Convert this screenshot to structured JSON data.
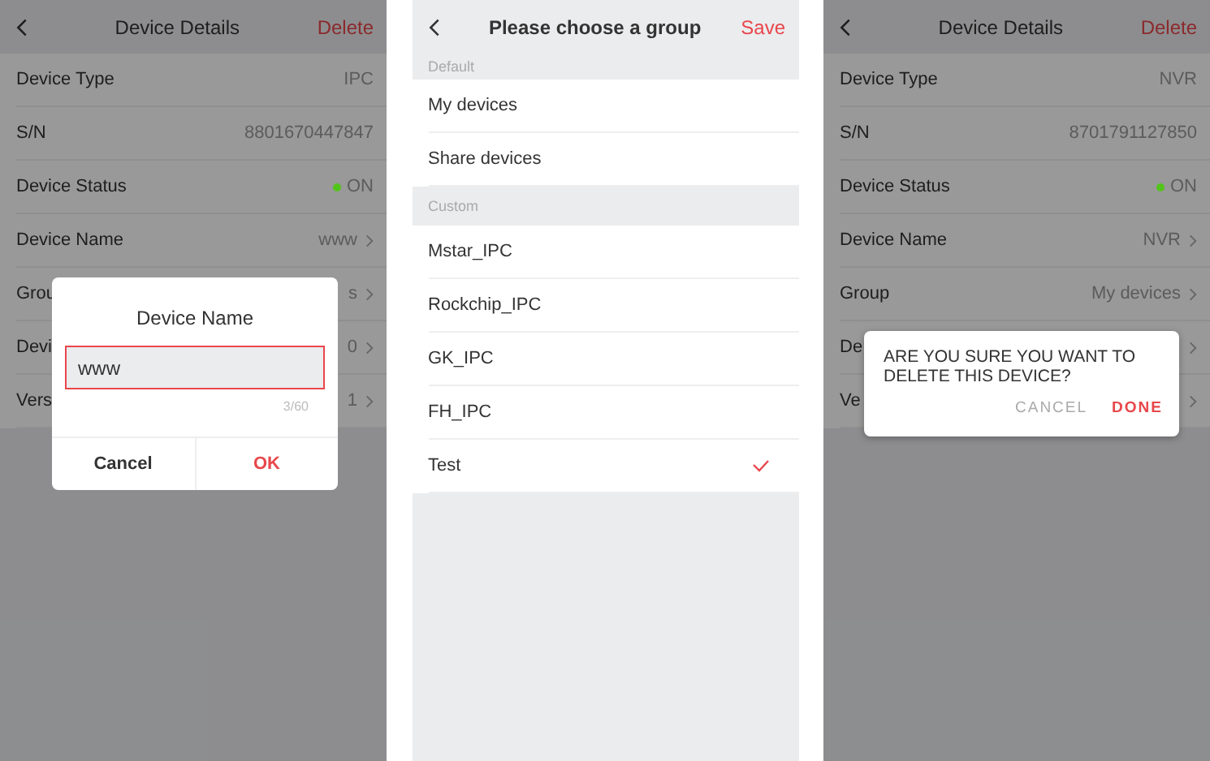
{
  "screens": [
    {
      "kind": "details",
      "header": {
        "title": "Device Details",
        "action": "Delete"
      },
      "rows": [
        {
          "kind": "plain",
          "label": "Device Type",
          "value": "IPC"
        },
        {
          "kind": "plain",
          "label": "S/N",
          "value": "8801670447847"
        },
        {
          "kind": "status",
          "label": "Device Status",
          "value": "ON",
          "color": "#52c41a"
        },
        {
          "kind": "link",
          "label": "Device Name",
          "value": "www"
        },
        {
          "kind": "link",
          "label": "Grou",
          "value": "s"
        },
        {
          "kind": "link",
          "label": "Devi",
          "value": "0"
        },
        {
          "kind": "link",
          "label": "Vers",
          "value": "1"
        }
      ],
      "dialog": {
        "kind": "input",
        "title": "Device Name",
        "value": "www",
        "counter": "3/60",
        "buttons": [
          {
            "label": "Cancel",
            "primary": false
          },
          {
            "label": "OK",
            "primary": true
          }
        ]
      }
    },
    {
      "kind": "groups",
      "header": {
        "title": "Please choose a group",
        "action": "Save"
      },
      "sections": [
        {
          "title": "Default",
          "items": [
            {
              "label": "My devices",
              "selected": false
            },
            {
              "label": "Share devices",
              "selected": false
            }
          ]
        },
        {
          "title": "Custom",
          "items": [
            {
              "label": "Mstar_IPC",
              "selected": false
            },
            {
              "label": "Rockchip_IPC",
              "selected": false
            },
            {
              "label": "GK_IPC",
              "selected": false
            },
            {
              "label": "FH_IPC",
              "selected": false
            },
            {
              "label": "Test",
              "selected": true
            }
          ]
        }
      ]
    },
    {
      "kind": "details",
      "header": {
        "title": "Device Details",
        "action": "Delete"
      },
      "rows": [
        {
          "kind": "plain",
          "label": "Device Type",
          "value": "NVR"
        },
        {
          "kind": "plain",
          "label": "S/N",
          "value": "8701791127850"
        },
        {
          "kind": "status",
          "label": "Device Status",
          "value": "ON",
          "color": "#52c41a"
        },
        {
          "kind": "link",
          "label": "Device Name",
          "value": "NVR"
        },
        {
          "kind": "link",
          "label": "Group",
          "value": "My devices"
        },
        {
          "kind": "link",
          "label": "De"
        },
        {
          "kind": "link",
          "label": "Ve"
        }
      ],
      "dialog": {
        "kind": "confirm",
        "message": "ARE YOU SURE YOU WANT TO DELETE THIS DEVICE?",
        "buttons": [
          {
            "label": "CANCEL",
            "primary": false
          },
          {
            "label": "DONE",
            "primary": true
          }
        ]
      }
    }
  ]
}
